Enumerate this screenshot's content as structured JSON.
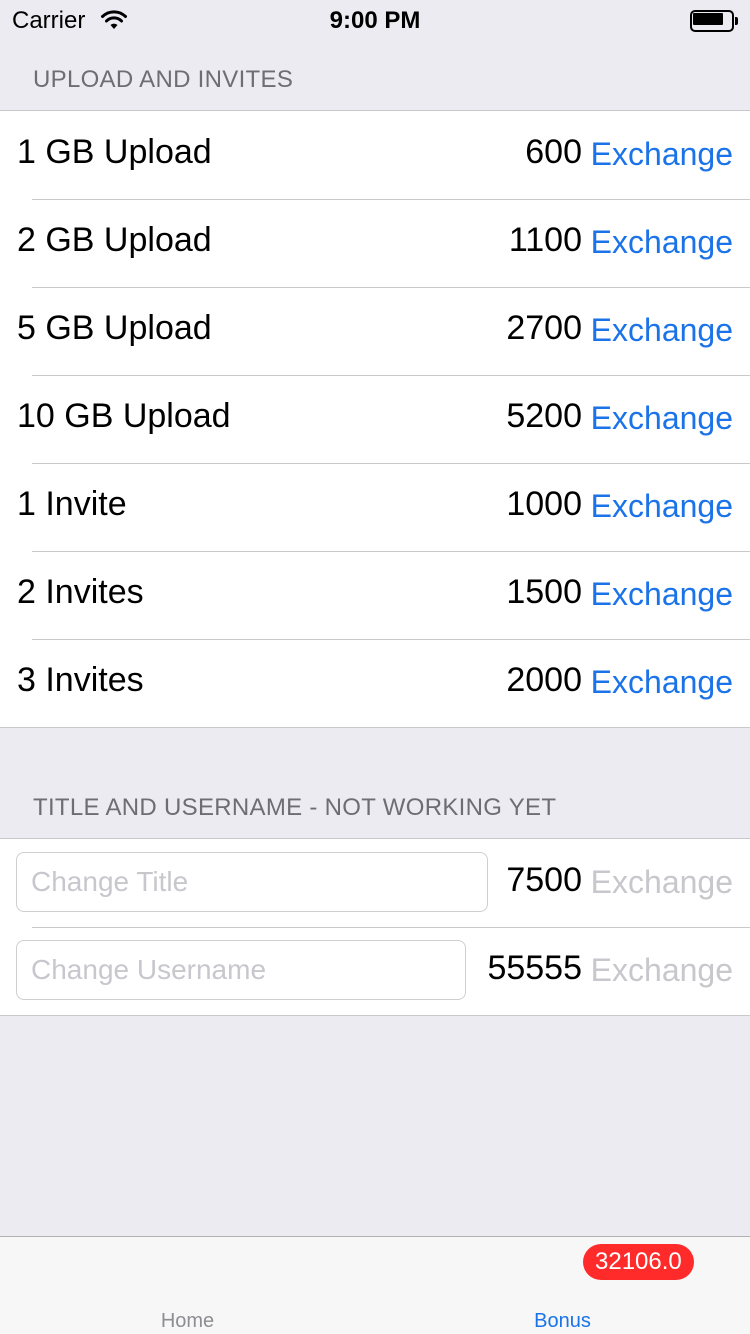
{
  "status_bar": {
    "carrier": "Carrier",
    "time": "9:00 PM"
  },
  "sections": {
    "upload_invites": {
      "header": "UPLOAD AND INVITES",
      "rows": [
        {
          "label": "1 GB Upload",
          "cost": "600",
          "action": "Exchange"
        },
        {
          "label": "2 GB Upload",
          "cost": "1100",
          "action": "Exchange"
        },
        {
          "label": "5 GB Upload",
          "cost": "2700",
          "action": "Exchange"
        },
        {
          "label": "10 GB Upload",
          "cost": "5200",
          "action": "Exchange"
        },
        {
          "label": "1 Invite",
          "cost": "1000",
          "action": "Exchange"
        },
        {
          "label": "2 Invites",
          "cost": "1500",
          "action": "Exchange"
        },
        {
          "label": "3 Invites",
          "cost": "2000",
          "action": "Exchange"
        }
      ]
    },
    "title_username": {
      "header": "TITLE AND USERNAME - NOT WORKING YET",
      "rows": [
        {
          "placeholder": "Change Title",
          "value": "",
          "cost": "7500",
          "action": "Exchange"
        },
        {
          "placeholder": "Change Username",
          "value": "",
          "cost": "55555",
          "action": "Exchange"
        }
      ]
    }
  },
  "tab_bar": {
    "tabs": [
      {
        "label": "Home",
        "selected": false
      },
      {
        "label": "Bonus",
        "selected": true
      }
    ],
    "badge": "32106.0"
  },
  "colors": {
    "accent": "#1a73e8",
    "disabled": "#c7c7cc",
    "badge": "#ff2b2b",
    "background": "#ebebf1"
  },
  "icons": [
    "wifi-icon",
    "battery-icon"
  ]
}
